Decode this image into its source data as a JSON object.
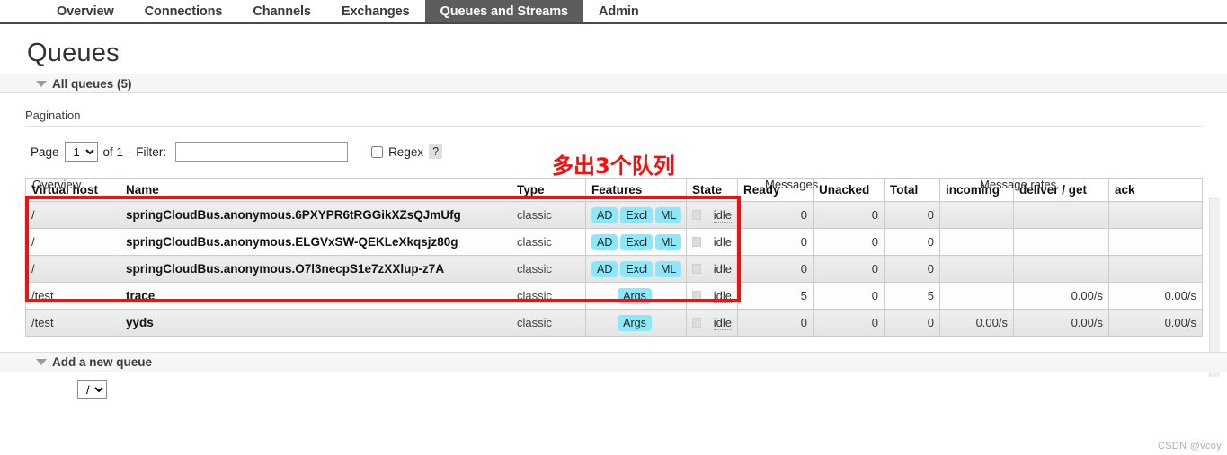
{
  "nav": {
    "tabs": [
      {
        "label": "Overview",
        "active": false
      },
      {
        "label": "Connections",
        "active": false
      },
      {
        "label": "Channels",
        "active": false
      },
      {
        "label": "Exchanges",
        "active": false
      },
      {
        "label": "Queues and Streams",
        "active": true
      },
      {
        "label": "Admin",
        "active": false
      }
    ]
  },
  "page": {
    "title": "Queues",
    "all_queues_label": "All queues (5)"
  },
  "pagination": {
    "legend": "Pagination",
    "page_label": "Page",
    "page_value": "1",
    "page_options": [
      "1"
    ],
    "of_label": "of 1",
    "filter_label": "- Filter:",
    "filter_value": "",
    "filter_placeholder": "",
    "regex_label": "Regex",
    "regex_checked": false,
    "help_label": "?"
  },
  "annotation": {
    "text": "多出3个队列",
    "color": "#fb0c0c"
  },
  "table": {
    "group_headers": [
      {
        "label": "Overview"
      },
      {
        "label": "Messages"
      },
      {
        "label": "Message rates"
      }
    ],
    "columns": [
      "Virtual host",
      "Name",
      "Type",
      "Features",
      "State",
      "Ready",
      "Unacked",
      "Total",
      "incoming",
      "deliver / get",
      "ack"
    ],
    "rows": [
      {
        "vhost": "/",
        "name": "springCloudBus.anonymous.6PXYPR6tRGGikXZsQJmUfg",
        "type": "classic",
        "features": [
          "AD",
          "Excl",
          "ML"
        ],
        "state": "idle",
        "ready": "0",
        "unacked": "0",
        "total": "0",
        "incoming": "",
        "deliver_get": "",
        "ack": ""
      },
      {
        "vhost": "/",
        "name": "springCloudBus.anonymous.ELGVxSW-QEKLeXkqsjz80g",
        "type": "classic",
        "features": [
          "AD",
          "Excl",
          "ML"
        ],
        "state": "idle",
        "ready": "0",
        "unacked": "0",
        "total": "0",
        "incoming": "",
        "deliver_get": "",
        "ack": ""
      },
      {
        "vhost": "/",
        "name": "springCloudBus.anonymous.O7l3necpS1e7zXXlup-z7A",
        "type": "classic",
        "features": [
          "AD",
          "Excl",
          "ML"
        ],
        "state": "idle",
        "ready": "0",
        "unacked": "0",
        "total": "0",
        "incoming": "",
        "deliver_get": "",
        "ack": ""
      },
      {
        "vhost": "/test",
        "name": "trace",
        "type": "classic",
        "features": [
          "Args"
        ],
        "state": "idle",
        "ready": "5",
        "unacked": "0",
        "total": "5",
        "incoming": "",
        "deliver_get": "0.00/s",
        "ack": "0.00/s"
      },
      {
        "vhost": "/test",
        "name": "yyds",
        "type": "classic",
        "features": [
          "Args"
        ],
        "state": "idle",
        "ready": "0",
        "unacked": "0",
        "total": "0",
        "incoming": "0.00/s",
        "deliver_get": "0.00/s",
        "ack": "0.00/s"
      }
    ]
  },
  "add_queue": {
    "section_label": "Add a new queue",
    "vhost_value": "/"
  },
  "watermark": {
    "text": "CSDN @vcoy"
  }
}
